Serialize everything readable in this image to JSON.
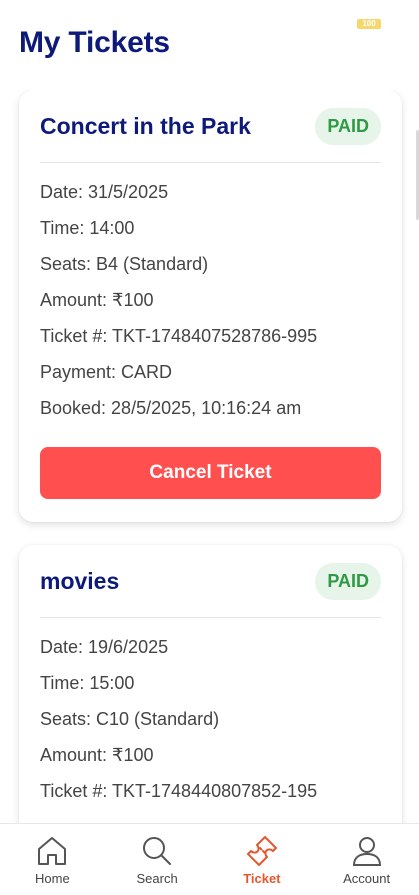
{
  "status": {
    "badge": "100"
  },
  "page": {
    "title": "My Tickets"
  },
  "tickets": [
    {
      "name": "Concert in the Park",
      "status": "PAID",
      "date": "Date: 31/5/2025",
      "time": "Time: 14:00",
      "seats": "Seats: B4 (Standard)",
      "amount": "Amount: ₹100",
      "ticket_no": "Ticket #: TKT-1748407528786-995",
      "payment": "Payment: CARD",
      "booked": "Booked: 28/5/2025, 10:16:24 am",
      "cancel_label": "Cancel Ticket"
    },
    {
      "name": "movies",
      "status": "PAID",
      "date": "Date: 19/6/2025",
      "time": "Time: 15:00",
      "seats": "Seats: C10 (Standard)",
      "amount": "Amount: ₹100",
      "ticket_no": "Ticket #: TKT-1748440807852-195"
    }
  ],
  "nav": {
    "items": [
      {
        "label": "Home",
        "icon": "home-icon"
      },
      {
        "label": "Search",
        "icon": "search-icon"
      },
      {
        "label": "Ticket",
        "icon": "ticket-icon",
        "active": true
      },
      {
        "label": "Account",
        "icon": "account-icon"
      }
    ],
    "active_color": "#e5572e"
  }
}
